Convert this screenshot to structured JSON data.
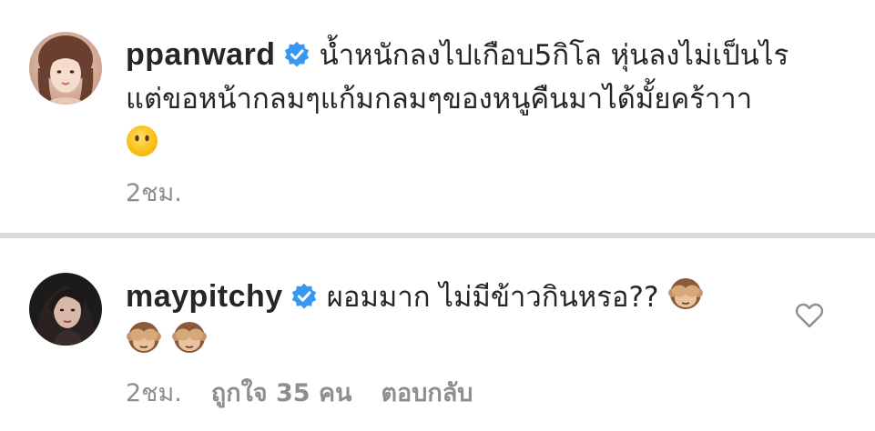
{
  "comments": [
    {
      "username": "ppanward",
      "verified": true,
      "text_line1": "น้ำหนักลงไปเกือบ5กิโล หุ่นลงไม่เป็นไร",
      "text_line2": "แต่ขอหน้ากลมๆแก้มกลมๆของหนูคืนมาได้มั้ยคร้าาา",
      "emoji": "no-mouth-face-emoji",
      "time": "2ชม."
    },
    {
      "username": "maypitchy",
      "verified": true,
      "text_line1": "ผอมมาก ไม่มีข้าวกินหรอ??",
      "emoji": "see-no-evil-monkey-emoji",
      "time": "2ชม.",
      "likes": "ถูกใจ 35 คน",
      "reply": "ตอบกลับ"
    }
  ],
  "colors": {
    "text": "#262626",
    "meta": "#8e8e8e",
    "verified": "#3897f0",
    "divider": "#d9d9d9"
  }
}
